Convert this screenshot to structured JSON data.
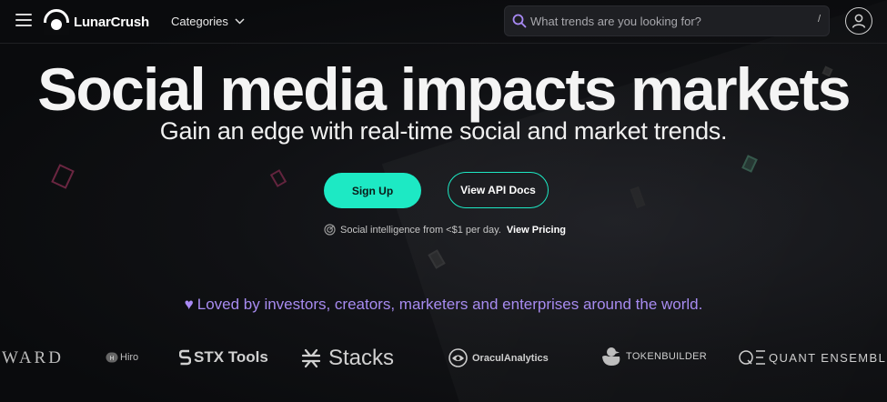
{
  "nav": {
    "logo_text": "LunarCrush",
    "categories_label": "Categories",
    "search_placeholder": "What trends are you looking for?",
    "search_shortcut": "/"
  },
  "hero": {
    "headline": "Social media impacts markets",
    "subheadline": "Gain an edge with real-time social and market trends.",
    "signup_label": "Sign Up",
    "api_docs_label": "View API Docs",
    "pricing_text": "Social intelligence from <$1 per day.",
    "pricing_link": "View Pricing"
  },
  "loved_text": "Loved by investors, creators, marketers and enterprises around the world.",
  "brands": [
    {
      "name": "WARD",
      "icon": "none"
    },
    {
      "name": "Hiro",
      "icon": "hiro-badge-icon"
    },
    {
      "name": "STX Tools",
      "icon": "stx-s-icon"
    },
    {
      "name": "Stacks",
      "icon": "stacks-asterisk-icon"
    },
    {
      "name": "OraculAnalytics",
      "icon": "oracul-eye-icon"
    },
    {
      "name": "TOKENBUILDER",
      "icon": "duck-icon"
    },
    {
      "name": "QUANT ENSEMBLE",
      "icon": "qe-monogram-icon"
    }
  ],
  "colors": {
    "accent": "#1de9c4",
    "loved_purple": "#a78bf0",
    "background": "#0b0c0e"
  }
}
